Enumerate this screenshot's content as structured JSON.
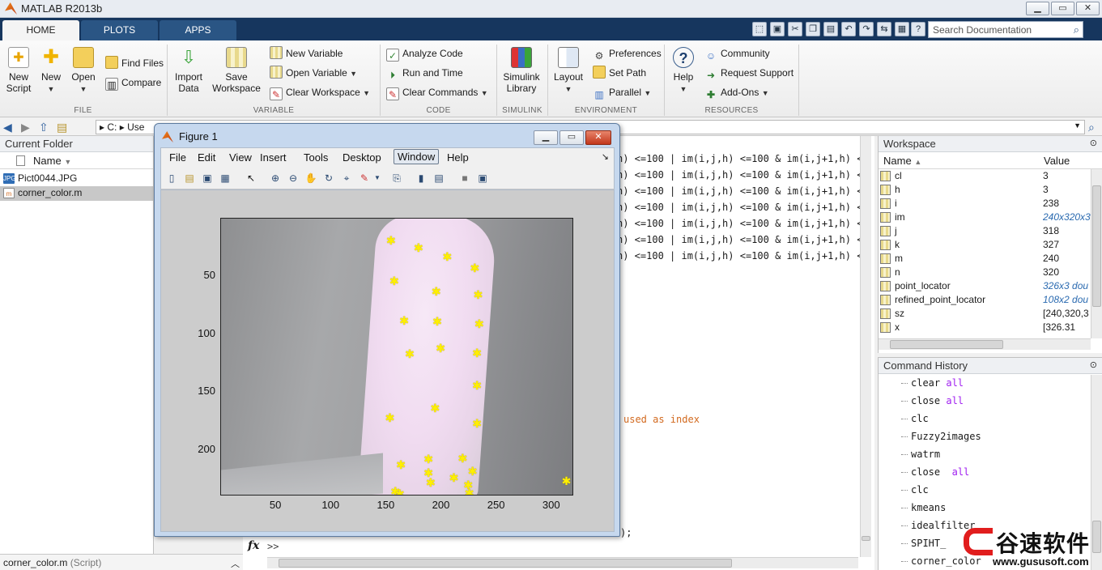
{
  "app": {
    "title": "MATLAB R2013b"
  },
  "window_buttons": {
    "minimize": "▁",
    "restore": "▭",
    "close": "✕"
  },
  "tabs": [
    {
      "label": "HOME",
      "active": true
    },
    {
      "label": "PLOTS",
      "active": false
    },
    {
      "label": "APPS",
      "active": false
    }
  ],
  "search": {
    "placeholder": "Search Documentation"
  },
  "ribbon": {
    "file": {
      "label": "FILE",
      "new_script": "New\nScript",
      "new": "New",
      "open": "Open",
      "find_files": "Find Files",
      "compare": "Compare"
    },
    "variable": {
      "label": "VARIABLE",
      "import_data": "Import\nData",
      "save_workspace": "Save\nWorkspace",
      "new_variable": "New Variable",
      "open_variable": "Open Variable",
      "clear_workspace": "Clear Workspace"
    },
    "code": {
      "label": "CODE",
      "analyze_code": "Analyze Code",
      "run_and_time": "Run and Time",
      "clear_commands": "Clear Commands"
    },
    "simulink": {
      "label": "SIMULINK",
      "library": "Simulink\nLibrary"
    },
    "environment": {
      "label": "ENVIRONMENT",
      "layout": "Layout",
      "preferences": "Preferences",
      "set_path": "Set Path",
      "parallel": "Parallel"
    },
    "resources": {
      "label": "RESOURCES",
      "help": "Help",
      "community": "Community",
      "request_support": "Request Support",
      "add_ons": "Add-Ons"
    }
  },
  "address": {
    "drive": "C:",
    "path_tail": "Use"
  },
  "current_folder": {
    "title": "Current Folder",
    "column": "Name",
    "files": [
      {
        "name": "Pict0044.JPG",
        "type": "jpg",
        "selected": false
      },
      {
        "name": "corner_color.m",
        "type": "m",
        "selected": true
      }
    ],
    "status": "corner_color.m",
    "status_type": "(Script)"
  },
  "command_window": {
    "lines": [
      "n) <=100 | im(i,j,h) <=100 & im(i,j+1,h) <",
      "n) <=100 | im(i,j,h) <=100 & im(i,j+1,h) <",
      "n) <=100 | im(i,j,h) <=100 & im(i,j+1,h) <",
      "n) <=100 | im(i,j,h) <=100 & im(i,j+1,h) <",
      "n) <=100 | im(i,j,h) <=100 & im(i,j+1,h) <",
      "n) <=100 | im(i,j,h) <=100 & im(i,j+1,h) <",
      "n) <=100 | im(i,j,h) <=100 & im(i,j+1,h) <"
    ],
    "comment_line": "used as index",
    "tail_line": ");",
    "prompt": ">>",
    "fx": "fx"
  },
  "workspace": {
    "title": "Workspace",
    "col_name": "Name",
    "col_value": "Value",
    "vars": [
      {
        "name": "cl",
        "value": "3",
        "italic": false
      },
      {
        "name": "h",
        "value": "3",
        "italic": false
      },
      {
        "name": "i",
        "value": "238",
        "italic": false
      },
      {
        "name": "im",
        "value": "240x320x3",
        "italic": true
      },
      {
        "name": "j",
        "value": "318",
        "italic": false
      },
      {
        "name": "k",
        "value": "327",
        "italic": false
      },
      {
        "name": "m",
        "value": "240",
        "italic": false
      },
      {
        "name": "n",
        "value": "320",
        "italic": false
      },
      {
        "name": "point_locator",
        "value": "326x3 dou",
        "italic": true
      },
      {
        "name": "refined_point_locator",
        "value": "108x2 dou",
        "italic": true
      },
      {
        "name": "sz",
        "value": "[240,320,3",
        "italic": false
      },
      {
        "name": "x",
        "value": "[326.31",
        "italic": false
      }
    ]
  },
  "command_history": {
    "title": "Command History",
    "items": [
      {
        "cmd": "clear",
        "arg": "all"
      },
      {
        "cmd": "close",
        "arg": "all"
      },
      {
        "cmd": "clc",
        "arg": ""
      },
      {
        "cmd": "Fuzzy2images",
        "arg": ""
      },
      {
        "cmd": "watrm",
        "arg": ""
      },
      {
        "cmd": "close ",
        "arg": "all"
      },
      {
        "cmd": "clc",
        "arg": ""
      },
      {
        "cmd": "kmeans",
        "arg": ""
      },
      {
        "cmd": "idealfilter",
        "arg": ""
      },
      {
        "cmd": "SPIHT_",
        "arg": ""
      },
      {
        "cmd": "corner_color",
        "arg": ""
      }
    ]
  },
  "figure": {
    "title": "Figure 1",
    "menus": [
      "File",
      "Edit",
      "View",
      "Insert",
      "Tools",
      "Desktop",
      "Window",
      "Help"
    ],
    "highlighted_menu": "Window",
    "corner_glyph": "↘"
  },
  "chart_data": {
    "type": "scatter",
    "title": "",
    "xlabel": "",
    "ylabel": "",
    "xlim": [
      0,
      320
    ],
    "ylim": [
      240,
      0
    ],
    "xticks": [
      50,
      100,
      150,
      200,
      250,
      300
    ],
    "yticks": [
      50,
      100,
      150,
      200
    ],
    "background": "image",
    "marker_color": "#ffef00",
    "series": [
      {
        "points": [
          [
            154,
            19
          ],
          [
            179,
            25
          ],
          [
            205,
            33
          ],
          [
            230,
            43
          ],
          [
            157,
            54
          ],
          [
            195,
            63
          ],
          [
            233,
            66
          ],
          [
            166,
            88
          ],
          [
            196,
            89
          ],
          [
            234,
            91
          ],
          [
            171,
            117
          ],
          [
            199,
            112
          ],
          [
            232,
            116
          ],
          [
            194,
            164
          ],
          [
            232,
            144
          ],
          [
            153,
            172
          ],
          [
            232,
            177
          ],
          [
            163,
            213
          ],
          [
            188,
            208
          ],
          [
            219,
            207
          ],
          [
            188,
            220
          ],
          [
            211,
            224
          ],
          [
            190,
            228
          ],
          [
            224,
            230
          ],
          [
            228,
            218
          ],
          [
            225,
            237
          ],
          [
            158,
            236
          ],
          [
            162,
            238
          ],
          [
            313,
            227
          ]
        ]
      }
    ]
  },
  "watermark": {
    "brand": "谷速软件",
    "url": "www.gususoft.com"
  }
}
